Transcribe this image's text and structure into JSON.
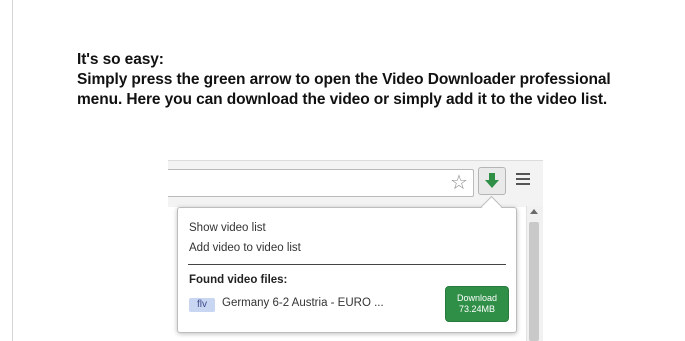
{
  "intro": {
    "heading": "It's so easy:",
    "line1": "Simply press the green arrow to open the Video Downloader professional",
    "line2": "menu. Here you can download the video or simply add it to the video list."
  },
  "toolbar": {
    "star_icon": "☆",
    "extension_icon": "green-down-arrow",
    "accent_color": "#2f8f47"
  },
  "popup": {
    "show_list": "Show video list",
    "add_to_list": "Add video to video list",
    "found_label": "Found video files:",
    "files": [
      {
        "format": "flv",
        "title": "Germany 6-2 Austria - EURO ...",
        "download_label": "Download",
        "size": "73.24MB"
      }
    ]
  }
}
